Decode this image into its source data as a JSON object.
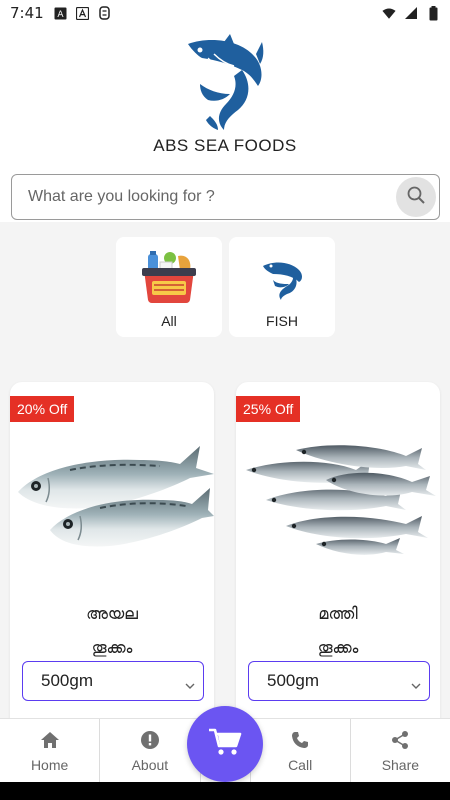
{
  "status_bar": {
    "time": "7:41",
    "notification_icons": [
      "a-box-icon",
      "keyboard-a-icon",
      "usb-icon"
    ],
    "system_icons": [
      "wifi-icon",
      "signal-icon",
      "battery-icon"
    ]
  },
  "header": {
    "brand_name": "ABS SEA FOODS",
    "logo_icon": "fish-logo-icon",
    "accent_color": "#1f5f9e"
  },
  "search": {
    "placeholder": "What are you looking for ?",
    "value": ""
  },
  "categories": [
    {
      "label": "All",
      "icon": "grocery-basket-icon"
    },
    {
      "label": "FISH",
      "icon": "fish-icon"
    }
  ],
  "products": [
    {
      "discount": "20% Off",
      "name": "അയല",
      "weight_label": "തൂക്കം",
      "selected_weight": "500gm",
      "image": "mackerel-image"
    },
    {
      "discount": "25% Off",
      "name": "മത്തി",
      "weight_label": "തൂക്കം",
      "selected_weight": "500gm",
      "image": "sardine-image"
    }
  ],
  "bottom_nav": {
    "items": [
      {
        "label": "Home",
        "icon": "home-icon"
      },
      {
        "label": "About",
        "icon": "info-icon"
      },
      {
        "label": "Call",
        "icon": "phone-icon"
      },
      {
        "label": "Share",
        "icon": "share-icon"
      }
    ],
    "cart_icon": "cart-icon",
    "cart_color": "#6b55f2"
  },
  "colors": {
    "badge": "#e53025",
    "select_border": "#5b3cf0",
    "content_bg": "#f4f4f4"
  }
}
